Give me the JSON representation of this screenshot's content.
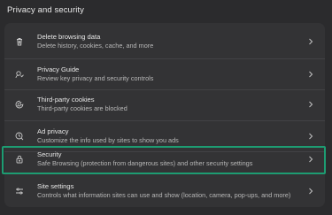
{
  "section": {
    "title": "Privacy and security"
  },
  "rows": [
    {
      "title": "Delete browsing data",
      "subtitle": "Delete history, cookies, cache, and more",
      "icon": "trash-icon"
    },
    {
      "title": "Privacy Guide",
      "subtitle": "Review key privacy and security controls",
      "icon": "privacy-guide-icon"
    },
    {
      "title": "Third-party cookies",
      "subtitle": "Third-party cookies are blocked",
      "icon": "cookie-icon"
    },
    {
      "title": "Ad privacy",
      "subtitle": "Customize the info used by sites to show you ads",
      "icon": "ad-privacy-icon"
    },
    {
      "title": "Security",
      "subtitle": "Safe Browsing (protection from dangerous sites) and other security settings",
      "icon": "lock-icon"
    },
    {
      "title": "Site settings",
      "subtitle": "Controls what information sites can use and show (location, camera, pop-ups, and more)",
      "icon": "sliders-icon"
    }
  ],
  "colors": {
    "highlight": "#1d9c72",
    "background": "#2b2b2d",
    "card": "#333335"
  }
}
